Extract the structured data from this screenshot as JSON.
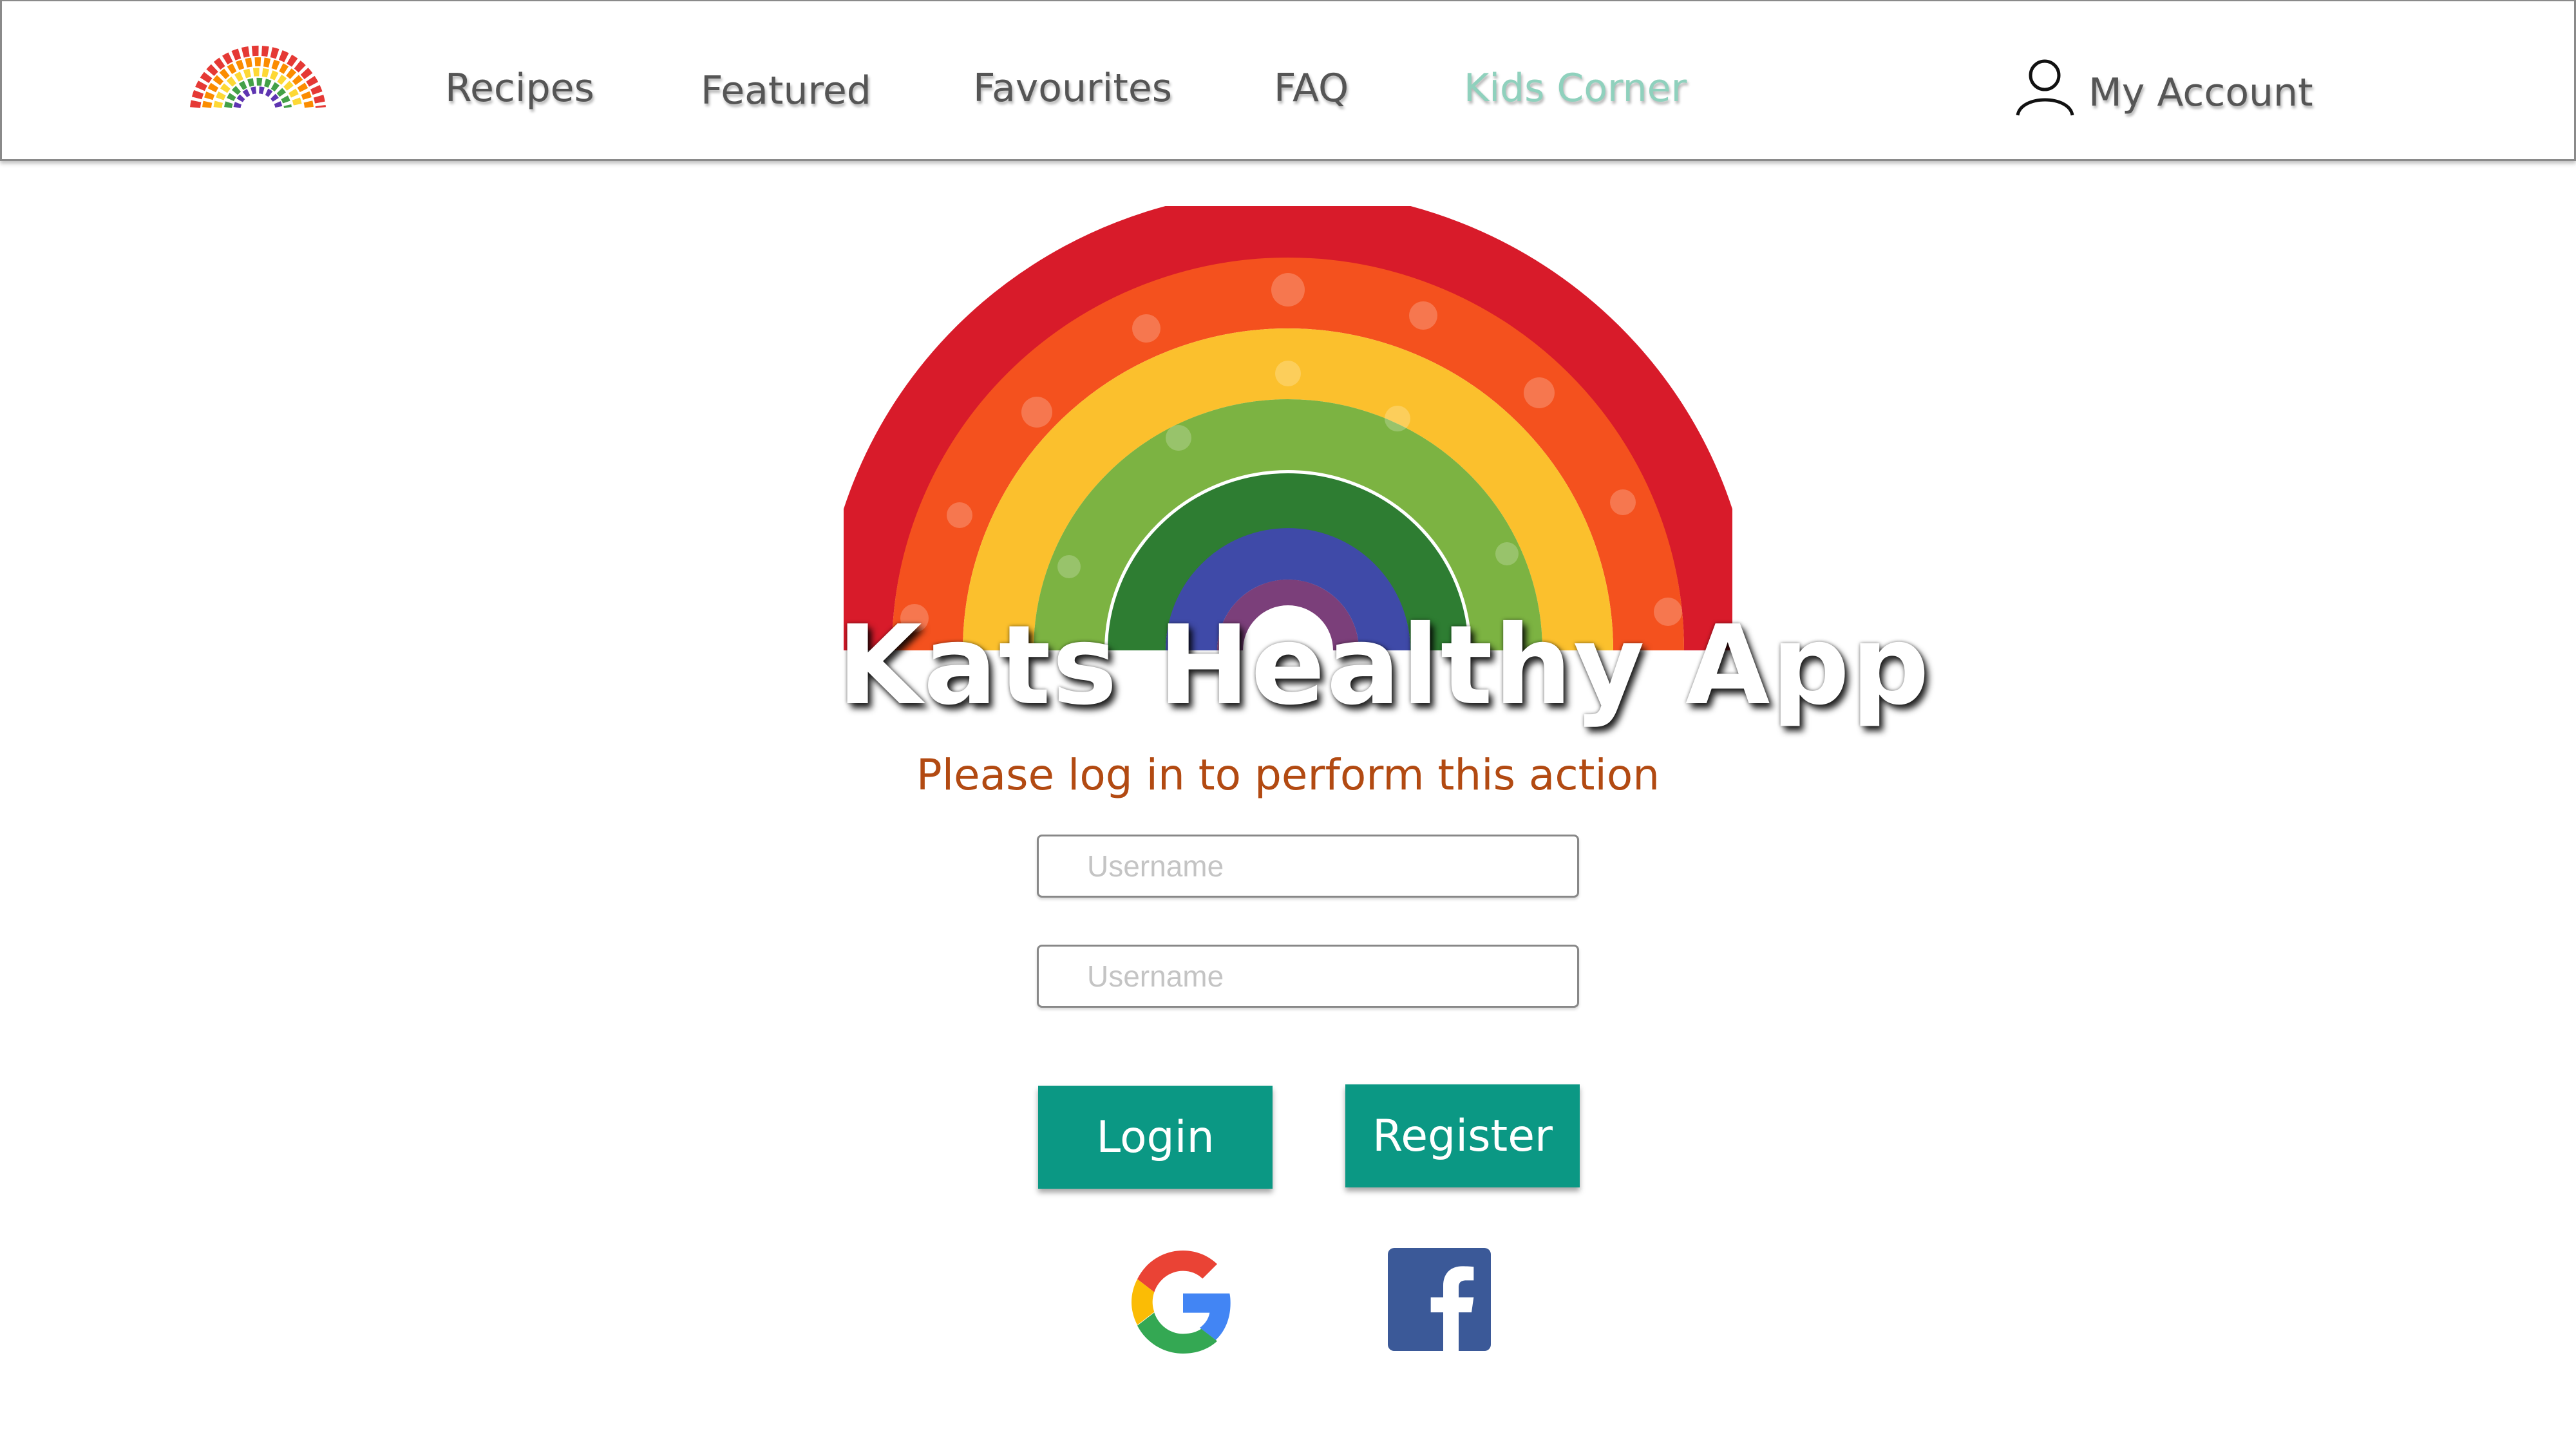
{
  "nav": {
    "logo_icon": "fruit-rainbow-logo",
    "items": [
      {
        "label": "Recipes"
      },
      {
        "label": "Featured"
      },
      {
        "label": "Favourites"
      },
      {
        "label": "FAQ"
      },
      {
        "label": "Kids Corner",
        "color": "#8fd1bd"
      }
    ],
    "account": {
      "icon": "user-icon",
      "label": "My Account"
    }
  },
  "hero": {
    "image": "fruit-vegetable-rainbow",
    "title": "Kats Healthy App"
  },
  "login": {
    "message": "Please log in to perform this action",
    "message_color": "#b24a12",
    "fields": [
      {
        "placeholder": "Username",
        "value": ""
      },
      {
        "placeholder": "Username",
        "value": ""
      }
    ],
    "login_label": "Login",
    "register_label": "Register",
    "button_color": "#0b9884",
    "social": [
      {
        "icon": "google-icon"
      },
      {
        "icon": "facebook-icon",
        "color": "#3b5998"
      }
    ]
  }
}
